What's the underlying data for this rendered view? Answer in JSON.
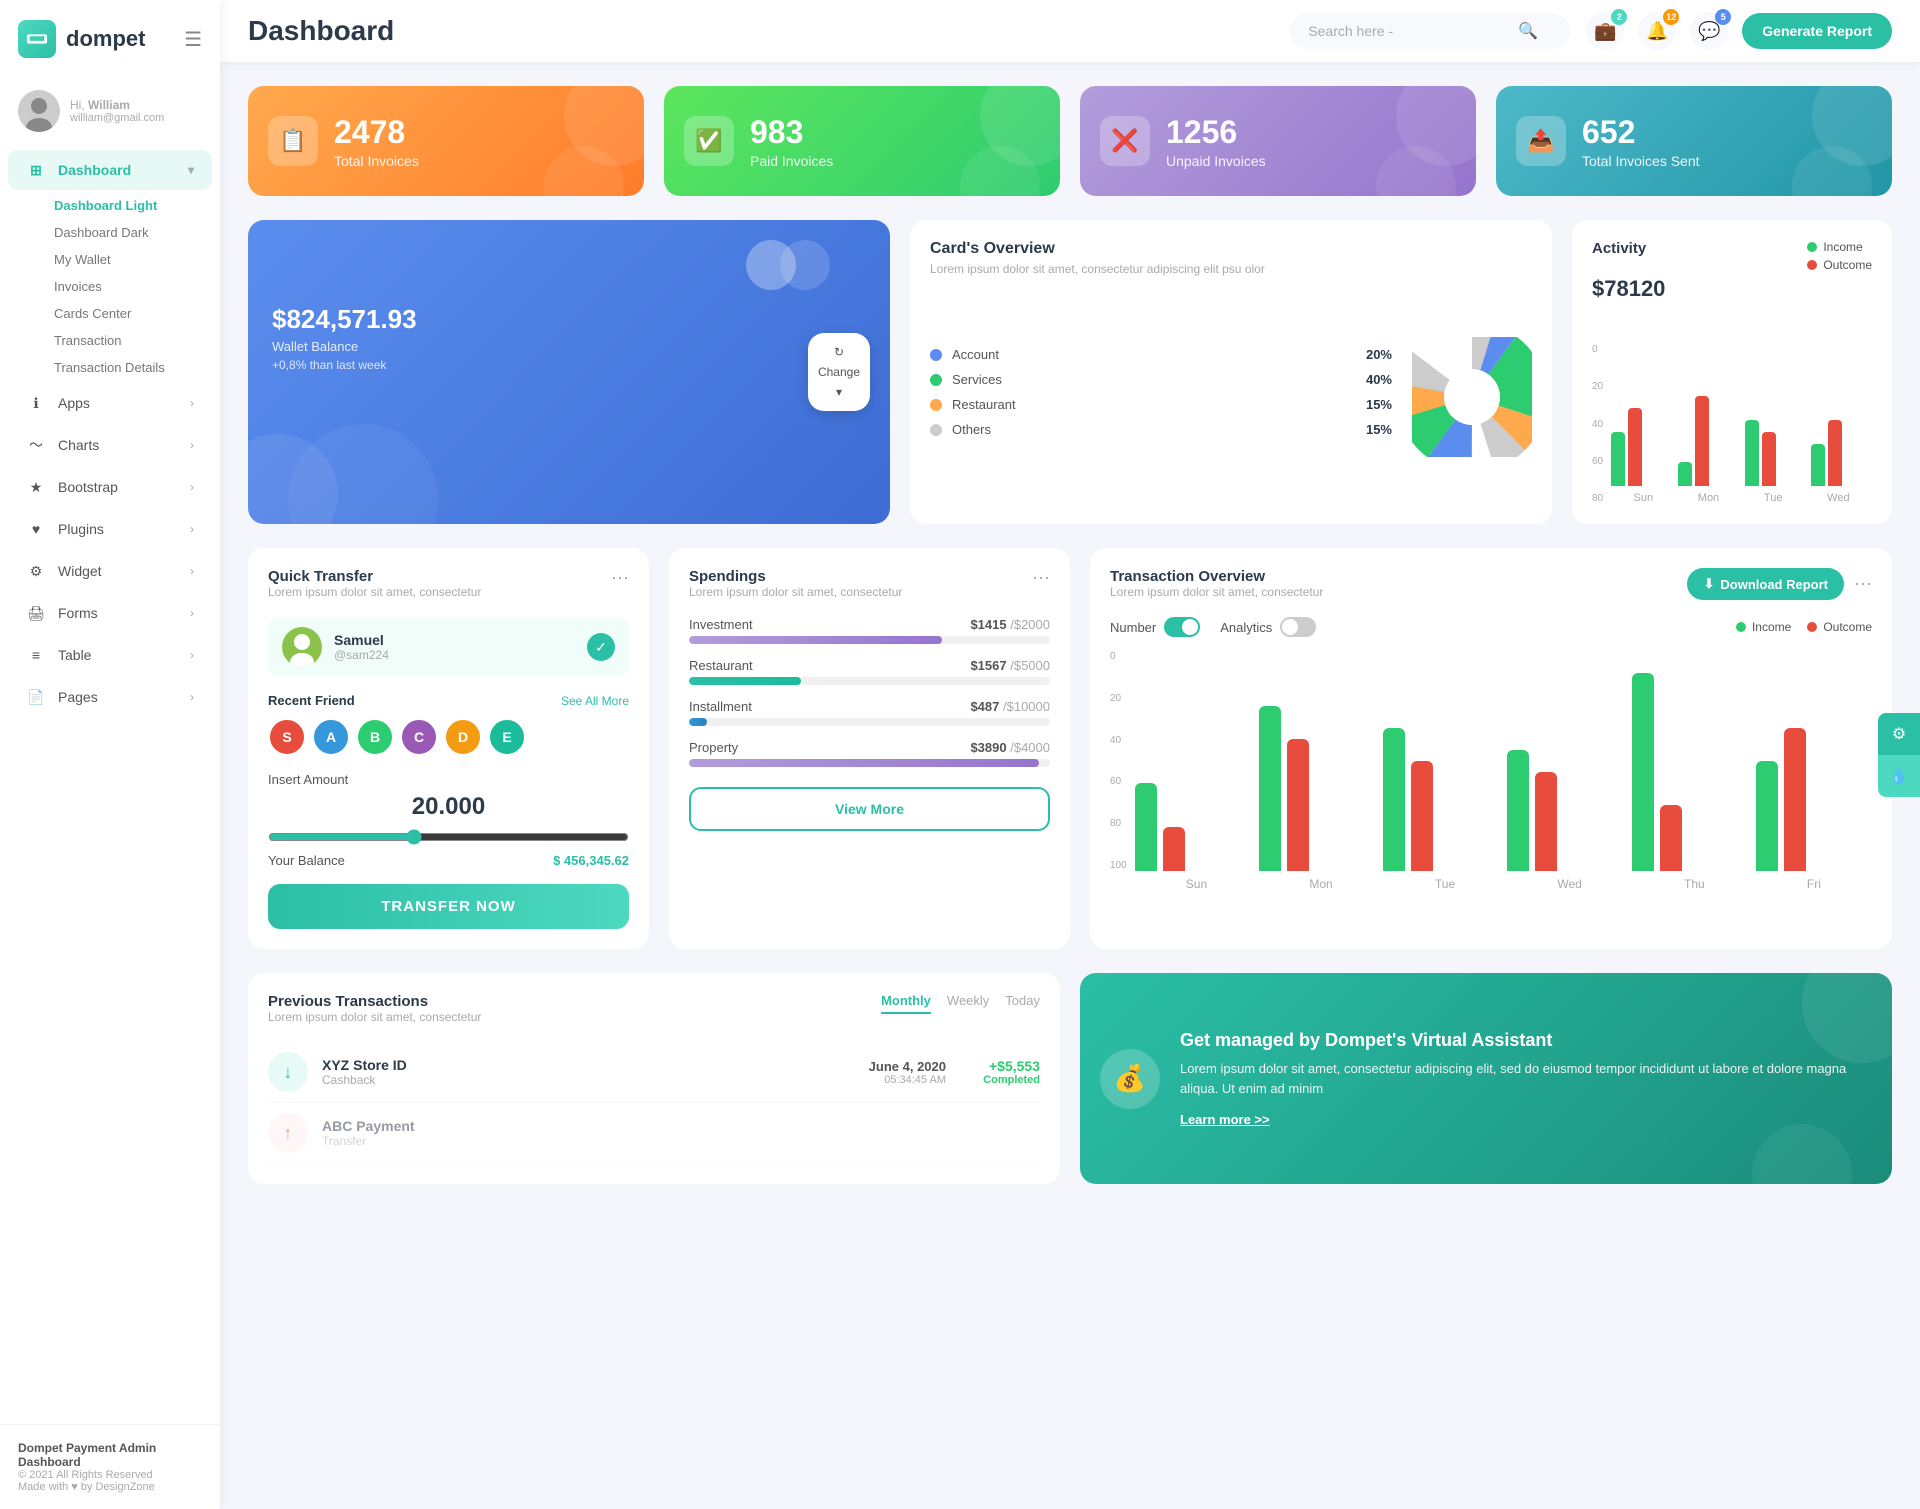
{
  "app": {
    "logo": "dompet",
    "hamburger": "☰"
  },
  "user": {
    "greeting": "Hi,",
    "name": "William",
    "email": "william@gmail.com"
  },
  "sidebar": {
    "main_items": [
      {
        "id": "dashboard",
        "label": "Dashboard",
        "icon": "grid",
        "active": true,
        "has_chevron": true
      },
      {
        "id": "apps",
        "label": "Apps",
        "icon": "apps",
        "active": false,
        "has_chevron": true
      },
      {
        "id": "charts",
        "label": "Charts",
        "icon": "chart",
        "active": false,
        "has_chevron": true
      },
      {
        "id": "bootstrap",
        "label": "Bootstrap",
        "icon": "star",
        "active": false,
        "has_chevron": true
      },
      {
        "id": "plugins",
        "label": "Plugins",
        "icon": "heart",
        "active": false,
        "has_chevron": true
      },
      {
        "id": "widget",
        "label": "Widget",
        "icon": "gear",
        "active": false,
        "has_chevron": true
      },
      {
        "id": "forms",
        "label": "Forms",
        "icon": "form",
        "active": false,
        "has_chevron": true
      },
      {
        "id": "table",
        "label": "Table",
        "icon": "table",
        "active": false,
        "has_chevron": true
      },
      {
        "id": "pages",
        "label": "Pages",
        "icon": "pages",
        "active": false,
        "has_chevron": true
      }
    ],
    "sub_items": [
      {
        "label": "Dashboard Light",
        "active": true
      },
      {
        "label": "Dashboard Dark",
        "active": false
      },
      {
        "label": "My Wallet",
        "active": false
      },
      {
        "label": "Invoices",
        "active": false
      },
      {
        "label": "Cards Center",
        "active": false
      },
      {
        "label": "Transaction",
        "active": false
      },
      {
        "label": "Transaction Details",
        "active": false
      }
    ]
  },
  "footer": {
    "brand": "Dompet Payment Admin Dashboard",
    "copy": "© 2021 All Rights Reserved",
    "made": "Made with ♥ by DesignZone"
  },
  "header": {
    "title": "Dashboard",
    "search_placeholder": "Search here -",
    "notifications": {
      "badge1": "2",
      "badge2": "12",
      "badge3": "5"
    },
    "generate_btn": "Generate Report"
  },
  "stats": [
    {
      "id": "total-invoices",
      "number": "2478",
      "label": "Total Invoices",
      "color": "orange",
      "icon": "📋"
    },
    {
      "id": "paid-invoices",
      "number": "983",
      "label": "Paid Invoices",
      "color": "green",
      "icon": "✅"
    },
    {
      "id": "unpaid-invoices",
      "number": "1256",
      "label": "Unpaid Invoices",
      "color": "purple",
      "icon": "❌"
    },
    {
      "id": "total-sent",
      "number": "652",
      "label": "Total Invoices Sent",
      "color": "teal",
      "icon": "📤"
    }
  ],
  "wallet": {
    "circles": true,
    "amount": "$824,571.93",
    "label": "Wallet Balance",
    "change": "+0,8% than last week",
    "change_btn": "Change"
  },
  "cards_overview": {
    "title": "Card's Overview",
    "desc": "Lorem ipsum dolor sit amet, consectetur adipiscing elit psu olor",
    "items": [
      {
        "label": "Account",
        "pct": "20%",
        "color": "blue"
      },
      {
        "label": "Services",
        "pct": "40%",
        "color": "green"
      },
      {
        "label": "Restaurant",
        "pct": "15%",
        "color": "orange"
      },
      {
        "label": "Others",
        "pct": "15%",
        "color": "gray"
      }
    ]
  },
  "activity": {
    "title": "Activity",
    "amount": "$78120",
    "income_label": "Income",
    "outcome_label": "Outcome",
    "y_labels": [
      "0",
      "20",
      "40",
      "60",
      "80"
    ],
    "x_labels": [
      "Sun",
      "Mon",
      "Tue",
      "Wed"
    ],
    "bars": [
      {
        "green": 45,
        "red": 65
      },
      {
        "green": 20,
        "red": 75
      },
      {
        "green": 55,
        "red": 45
      },
      {
        "green": 35,
        "red": 55
      }
    ]
  },
  "quick_transfer": {
    "title": "Quick Transfer",
    "desc": "Lorem ipsum dolor sit amet, consectetur",
    "contact": {
      "name": "Samuel",
      "id": "@sam224"
    },
    "recent_label": "Recent Friend",
    "see_all": "See All More",
    "friends": [
      "S",
      "A",
      "B",
      "C",
      "D",
      "E"
    ],
    "friend_colors": [
      "#e74c3c",
      "#3498db",
      "#2ecc71",
      "#9b59b6",
      "#f39c12",
      "#1abc9c"
    ],
    "insert_label": "Insert Amount",
    "amount": "20.000",
    "balance_label": "Your Balance",
    "balance_value": "$ 456,345.62",
    "btn_label": "TRANSFER NOW"
  },
  "spendings": {
    "title": "Spendings",
    "desc": "Lorem ipsum dolor sit amet, consectetur",
    "items": [
      {
        "label": "Investment",
        "amount": "$1415",
        "limit": "$2000",
        "pct": 70,
        "color": "#9b59b6"
      },
      {
        "label": "Restaurant",
        "amount": "$1567",
        "limit": "$5000",
        "pct": 31,
        "color": "#2bbfa6"
      },
      {
        "label": "Installment",
        "amount": "$487",
        "limit": "$10000",
        "pct": 5,
        "color": "#3498db"
      },
      {
        "label": "Property",
        "amount": "$3890",
        "limit": "$4000",
        "pct": 97,
        "color": "#9b59b6"
      }
    ],
    "view_more": "View More"
  },
  "transaction_overview": {
    "title": "Transaction Overview",
    "desc": "Lorem ipsum dolor sit amet, consectetur",
    "download_btn": "Download Report",
    "number_label": "Number",
    "analytics_label": "Analytics",
    "income_label": "Income",
    "outcome_label": "Outcome",
    "x_labels": [
      "Sun",
      "Mon",
      "Tue",
      "Wed",
      "Thu",
      "Fri"
    ],
    "y_labels": [
      "0",
      "20",
      "40",
      "60",
      "80",
      "100"
    ],
    "bars": [
      {
        "green": 40,
        "red": 20
      },
      {
        "green": 75,
        "red": 60
      },
      {
        "green": 65,
        "red": 50
      },
      {
        "green": 55,
        "red": 45
      },
      {
        "green": 90,
        "red": 30
      },
      {
        "green": 50,
        "red": 65
      }
    ]
  },
  "prev_transactions": {
    "title": "Previous Transactions",
    "desc": "Lorem ipsum dolor sit amet, consectetur",
    "tabs": [
      "Monthly",
      "Weekly",
      "Today"
    ],
    "active_tab": "Monthly",
    "items": [
      {
        "name": "XYZ Store ID",
        "type": "Cashback",
        "date": "June 4, 2020",
        "time": "05:34:45 AM",
        "amount": "+$5,553",
        "status": "Completed",
        "icon": "↓"
      }
    ]
  },
  "promo": {
    "title": "Get managed by Dompet's Virtual Assistant",
    "desc": "Lorem ipsum dolor sit amet, consectetur adipiscing elit, sed do eiusmod tempor incididunt ut labore et dolore magna aliqua. Ut enim ad minim",
    "link": "Learn more >>"
  }
}
